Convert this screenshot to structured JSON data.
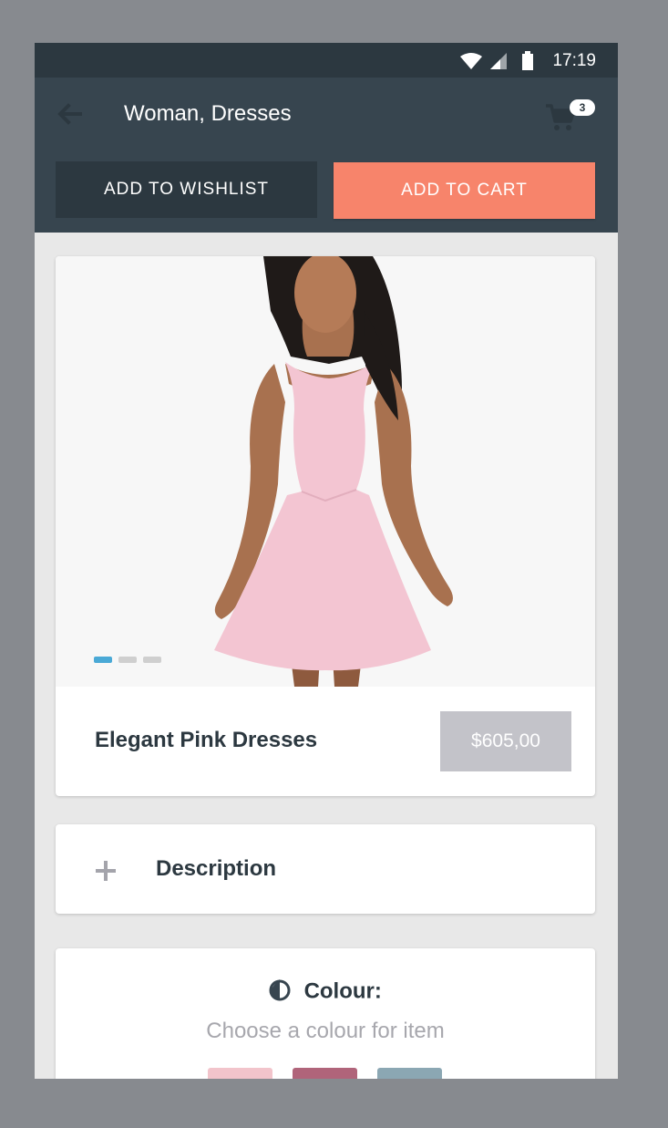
{
  "status_bar": {
    "time": "17:19"
  },
  "app_bar": {
    "title": "Woman, Dresses",
    "cart_count": "3",
    "icons": [
      "arrow-back-icon",
      "shopping-cart-icon"
    ]
  },
  "actions": {
    "wishlist_label": "ADD TO WISHLIST",
    "cart_label": "ADD TO CART"
  },
  "product": {
    "name": "Elegant Pink Dresses",
    "price": "$605,00",
    "image_count": 3,
    "active_image": 1
  },
  "description": {
    "label": "Description"
  },
  "colour": {
    "title": "Colour:",
    "subtitle": "Choose a colour for item",
    "swatches": [
      "#f2c4cb",
      "#b0647a",
      "#8ba7b3"
    ]
  },
  "colors": {
    "status_bar": "#2c3840",
    "app_bar": "#37454f",
    "accent": "#f7846b",
    "price_bg": "#c3c3c9",
    "dot_active": "#4aa9d6"
  }
}
